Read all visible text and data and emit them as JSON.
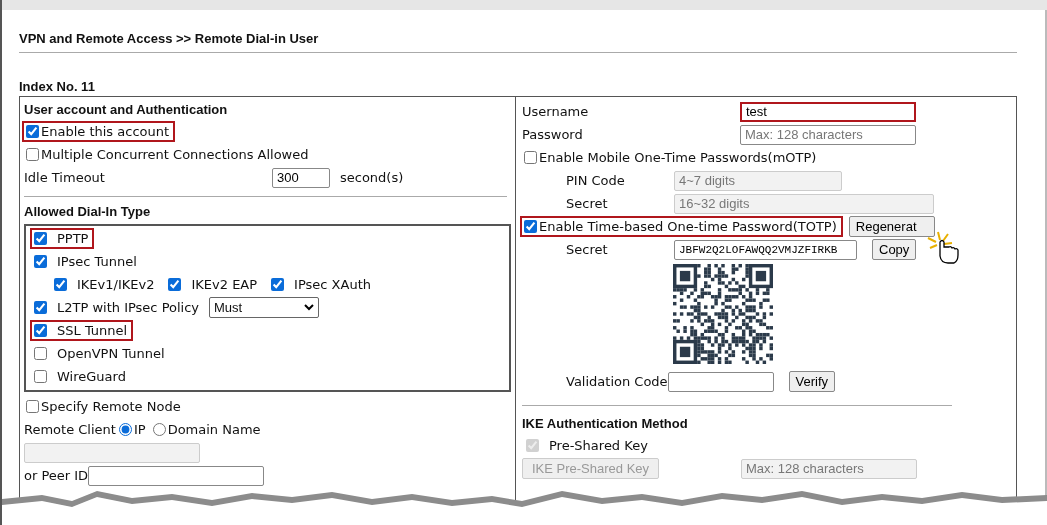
{
  "title": "VPN and Remote Access >> Remote Dial-in User",
  "index_label": "Index No. 11",
  "left": {
    "account_heading": "User account and Authentication",
    "enable_account": {
      "label": "Enable this account",
      "checked": true,
      "highlighted": true
    },
    "multiple_connections": {
      "label": "Multiple Concurrent Connections Allowed",
      "checked": false
    },
    "idle_timeout": {
      "label": "Idle Timeout",
      "value": "300",
      "unit": "second(s)"
    },
    "dialin_heading": "Allowed Dial-In Type",
    "dialin_types": [
      {
        "kind": "check",
        "label": "PPTP",
        "checked": true,
        "highlighted": true
      },
      {
        "kind": "check",
        "label": "IPsec Tunnel",
        "checked": true,
        "highlighted": false
      },
      {
        "kind": "subchecks",
        "options": [
          {
            "label": "IKEv1/IKEv2",
            "checked": true
          },
          {
            "label": "IKEv2 EAP",
            "checked": true
          },
          {
            "label": "IPsec XAuth",
            "checked": true
          }
        ]
      },
      {
        "kind": "select",
        "label": "L2TP with IPsec Policy",
        "checked": true,
        "highlighted": false,
        "value": "Must"
      },
      {
        "kind": "check",
        "label": "SSL Tunnel",
        "checked": true,
        "highlighted": true
      },
      {
        "kind": "check",
        "label": "OpenVPN Tunnel",
        "checked": false,
        "highlighted": false
      },
      {
        "kind": "check",
        "label": "WireGuard",
        "checked": false,
        "highlighted": false
      }
    ],
    "specify_remote_node": {
      "label": "Specify Remote Node",
      "checked": false
    },
    "remote_client": {
      "label": "Remote Client",
      "options": [
        {
          "label": "IP",
          "selected": true
        },
        {
          "label": "Domain Name",
          "selected": false
        }
      ]
    },
    "peer_id": {
      "label": "or Peer ID"
    }
  },
  "right": {
    "username": {
      "label": "Username",
      "value": "test",
      "highlighted": true
    },
    "password": {
      "label": "Password",
      "placeholder": "Max: 128 characters"
    },
    "motp": {
      "label": "Enable Mobile One-Time Passwords(mOTP)",
      "checked": false,
      "pin_code": {
        "label": "PIN Code",
        "placeholder": "4~7 digits"
      },
      "secret": {
        "label": "Secret",
        "placeholder": "16~32 digits"
      }
    },
    "totp": {
      "label": "Enable Time-based One-time Password(TOTP)",
      "checked": true,
      "highlighted": true,
      "regenerate_button": "Regenerat",
      "secret": {
        "label": "Secret",
        "value": "JBFW2Q2LOFAWQQ2VMJZFIRKB"
      },
      "copy_button": "Copy",
      "validation_code": {
        "label": "Validation Code"
      },
      "verify_button": "Verify"
    },
    "ike": {
      "heading": "IKE Authentication Method",
      "pre_shared_key": {
        "label": "Pre-Shared Key",
        "checked": true,
        "disabled": true
      },
      "key_button": "IKE Pre-Shared Key",
      "key_field": {
        "placeholder": "Max: 128 characters"
      }
    }
  }
}
